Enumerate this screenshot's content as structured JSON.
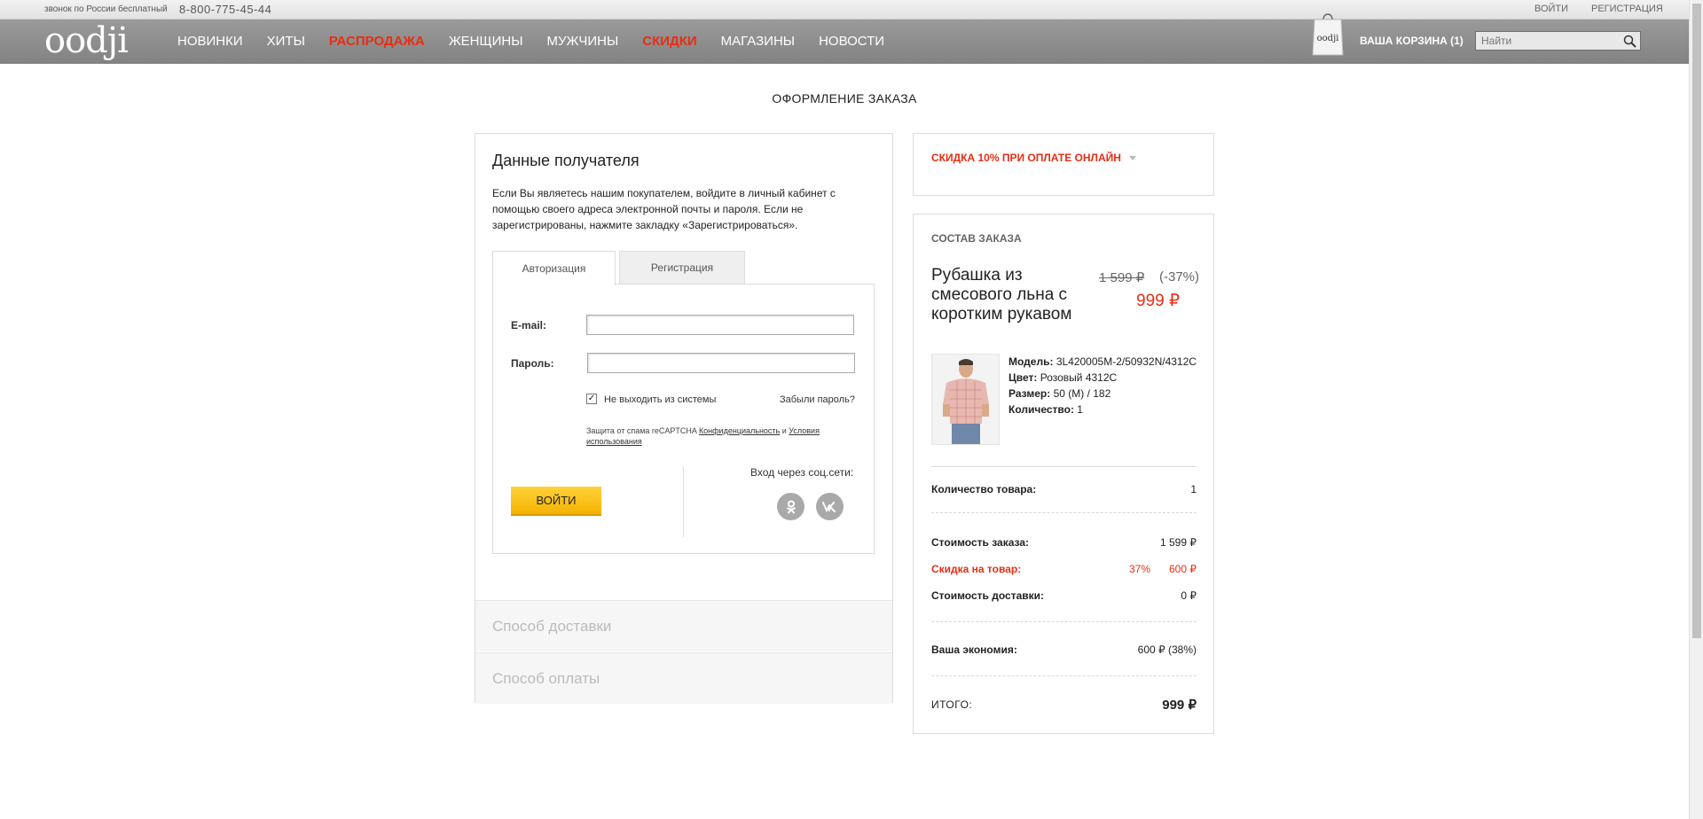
{
  "topbar": {
    "call_text": "звонок по России бесплатный",
    "phone": "8-800-775-45-44",
    "login": "ВОЙТИ",
    "register": "РЕГИСТРАЦИЯ"
  },
  "header": {
    "logo": "oodji",
    "nav": [
      {
        "label": "НОВИНКИ",
        "highlight": false
      },
      {
        "label": "ХИТЫ",
        "highlight": false
      },
      {
        "label": "РАСПРОДАЖА",
        "highlight": true
      },
      {
        "label": "ЖЕНЩИНЫ",
        "highlight": false
      },
      {
        "label": "МУЖЧИНЫ",
        "highlight": false
      },
      {
        "label": "СКИДКИ",
        "highlight": true
      },
      {
        "label": "МАГАЗИНЫ",
        "highlight": false
      },
      {
        "label": "НОВОСТИ",
        "highlight": false
      }
    ],
    "bag_logo": "oodji",
    "cart": "ВАША КОРЗИНА (1)",
    "search_placeholder": "Найти"
  },
  "page_title": "ОФОРМЛЕНИЕ ЗАКАЗА",
  "recipient": {
    "title": "Данные получателя",
    "description": "Если Вы являетесь нашим покупателем, войдите в личный кабинет с помощью своего адреса электронной почты и пароля. Если не зарегистрированы, нажмите закладку «Зарегистрироваться».",
    "tabs": [
      "Авторизация",
      "Регистрация"
    ],
    "email_label": "E-mail:",
    "email_value": "",
    "password_label": "Пароль:",
    "password_value": "",
    "remember_label": "Не выходить из системы",
    "remember_checked": true,
    "forgot": "Забыли пароль?",
    "captcha_prefix": "Защита от спама reCAPTCHA",
    "captcha_privacy": "Конфиденциальность",
    "captcha_and": "и",
    "captcha_terms": "Условия использования",
    "login_button": "ВОЙТИ",
    "social_label": "Вход через соц.сети:",
    "social": [
      "ok-icon",
      "vk-icon"
    ]
  },
  "sections": {
    "delivery": "Способ доставки",
    "payment": "Способ оплаты"
  },
  "promo": {
    "text": "СКИДКА 10% ПРИ ОПЛАТЕ ОНЛАЙН"
  },
  "order": {
    "title": "СОСТАВ ЗАКАЗА",
    "product": {
      "name": "Рубашка из смесового льна с коротким рукавом",
      "old_price": "1 599 ₽",
      "discount": "(-37%)",
      "price": "999 ₽",
      "model_label": "Модель:",
      "model": "3L420005M-2/50932N/4312C",
      "color_label": "Цвет:",
      "color": "Розовый 4312С",
      "size_label": "Размер:",
      "size": "50 (M) / 182",
      "qty_label": "Количество:",
      "qty": "1"
    },
    "items_count_label": "Количество товара:",
    "items_count": "1",
    "cost_label": "Стоимость заказа:",
    "cost": "1 599 ₽",
    "discount_label": "Скидка на товар:",
    "discount_pct": "37%",
    "discount_value": "600 ₽",
    "delivery_label": "Стоимость доставки:",
    "delivery_value": "0 ₽",
    "savings_label": "Ваша экономия:",
    "savings_value": "600 ₽ (38%)",
    "total_label": "ИТОГО:",
    "total_value": "999 ₽"
  },
  "colors": {
    "accent_red": "#e62e14",
    "button_yellow": "#f4b300",
    "nav_gray": "#8c8c8c"
  }
}
